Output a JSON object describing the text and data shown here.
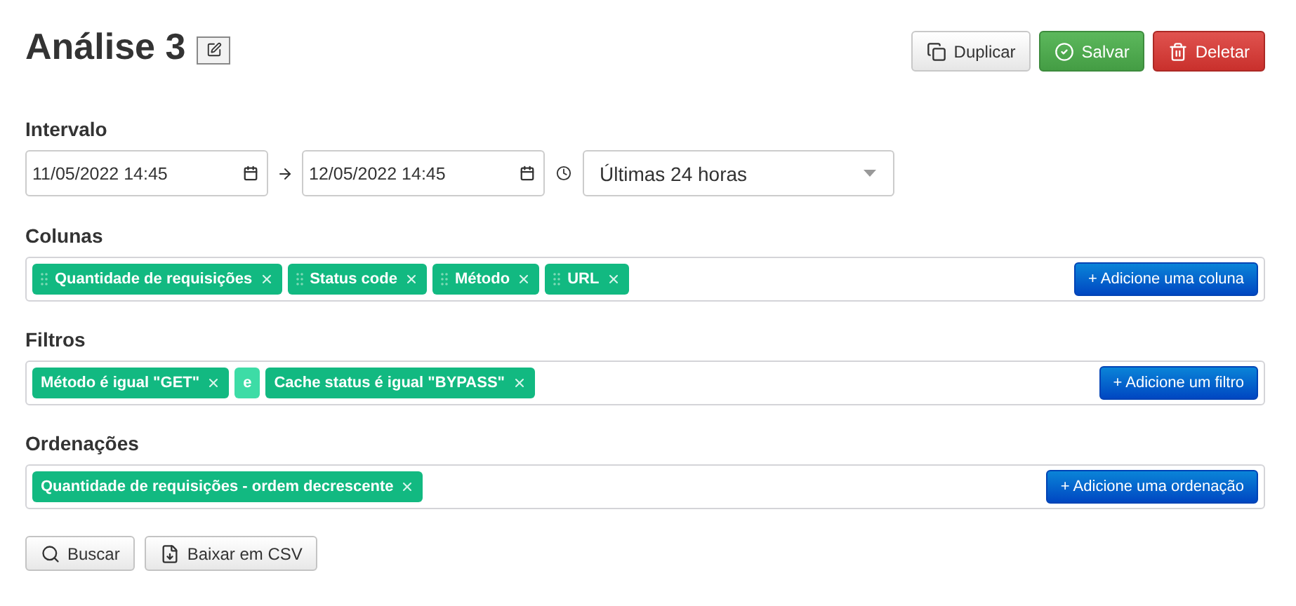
{
  "title": "Análise 3",
  "actions": [
    {
      "label": "Duplicar",
      "kind": "default"
    },
    {
      "label": "Salvar",
      "kind": "success"
    },
    {
      "label": "Deletar",
      "kind": "danger"
    }
  ],
  "interval": {
    "label": "Intervalo",
    "start": "11/05/2022 14:45",
    "end": "12/05/2022 14:45",
    "preset": "Últimas 24 horas"
  },
  "sections": [
    {
      "title": "Colunas",
      "items": [
        {
          "kind": "chip",
          "label": "Quantidade de requisições",
          "draggable": true
        },
        {
          "kind": "chip",
          "label": "Status code",
          "draggable": true
        },
        {
          "kind": "chip",
          "label": "Método",
          "draggable": true
        },
        {
          "kind": "chip",
          "label": "URL",
          "draggable": true
        }
      ],
      "add_button": "+ Adicione uma coluna"
    },
    {
      "title": "Filtros",
      "items": [
        {
          "kind": "chip",
          "label": "Método é igual \"GET\"",
          "draggable": false
        },
        {
          "kind": "connector",
          "label": "e"
        },
        {
          "kind": "chip",
          "label": "Cache status é igual \"BYPASS\"",
          "draggable": false
        }
      ],
      "add_button": "+ Adicione um filtro"
    },
    {
      "title": "Ordenações",
      "items": [
        {
          "kind": "chip",
          "label": "Quantidade de requisições - ordem decrescente",
          "draggable": false
        }
      ],
      "add_button": "+ Adicione uma ordenação"
    }
  ],
  "footer_buttons": [
    {
      "label": "Buscar",
      "kind": "search"
    },
    {
      "label": "Baixar em CSV",
      "kind": "download"
    }
  ]
}
